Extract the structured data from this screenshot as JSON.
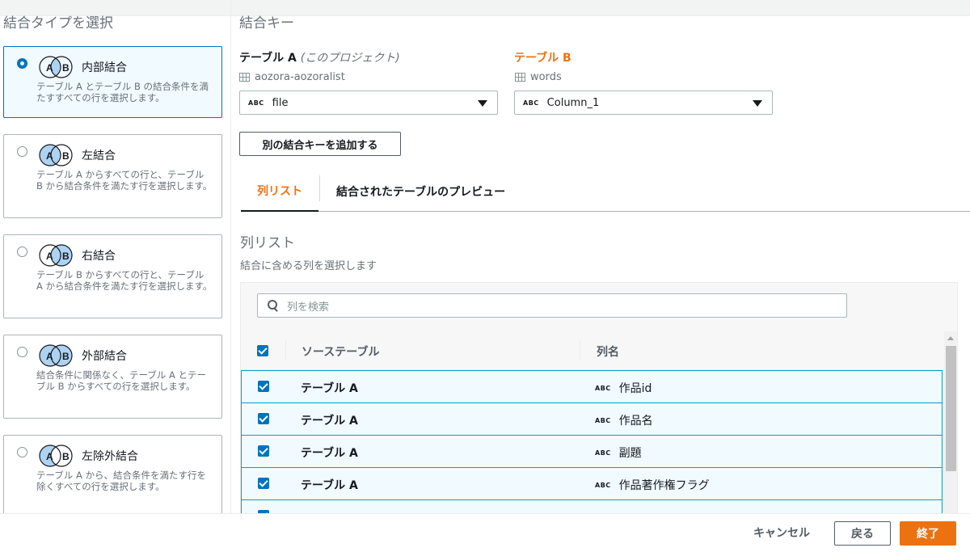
{
  "left_panel": {
    "title": "結合タイプを選択",
    "join_types": [
      {
        "name": "内部結合",
        "description": "テーブル A とテーブル B の結合条件を満たすすべての行を選択します。",
        "selected": true,
        "fill": "inner"
      },
      {
        "name": "左結合",
        "description": "テーブル A からすべての行と、テーブル B から結合条件を満たす行を選択します。",
        "selected": false,
        "fill": "left"
      },
      {
        "name": "右結合",
        "description": "テーブル B からすべての行と、テーブル A から結合条件を満たす行を選択します。",
        "selected": false,
        "fill": "right"
      },
      {
        "name": "外部結合",
        "description": "結合条件に関係なく、テーブル A とテーブル B からすべての行を選択します。",
        "selected": false,
        "fill": "outer"
      },
      {
        "name": "左除外結合",
        "description": "テーブル A から、結合条件を満たす行を除くすべての行を選択します。",
        "selected": false,
        "fill": "left-excl"
      }
    ],
    "venn_labels": {
      "a": "A",
      "b": "B"
    }
  },
  "join_key": {
    "title": "結合キー",
    "table_a": {
      "label": "テーブル A",
      "sublabel": "(このプロジェクト)",
      "table_name": "aozora-aozoralist",
      "selected_column": "file",
      "type": "ABC"
    },
    "table_b": {
      "label": "テーブル B",
      "table_name": "words",
      "selected_column": "Column_1",
      "type": "ABC"
    },
    "add_key_button": "別の結合キーを追加する"
  },
  "tabs": [
    {
      "label": "列リスト",
      "active": true
    },
    {
      "label": "結合されたテーブルのプレビュー",
      "active": false
    }
  ],
  "column_list": {
    "title": "列リスト",
    "subtitle": "結合に含める列を選択します",
    "search_placeholder": "列を検索",
    "headers": {
      "source": "ソーステーブル",
      "column": "列名"
    },
    "rows": [
      {
        "source": "テーブル A",
        "type": "ABC",
        "column": "作品id",
        "checked": true
      },
      {
        "source": "テーブル A",
        "type": "ABC",
        "column": "作品名",
        "checked": true
      },
      {
        "source": "テーブル A",
        "type": "ABC",
        "column": "副題",
        "checked": true
      },
      {
        "source": "テーブル A",
        "type": "ABC",
        "column": "作品著作権フラグ",
        "checked": true
      }
    ]
  },
  "footer": {
    "cancel": "キャンセル",
    "back": "戻る",
    "finish": "終了"
  },
  "colors": {
    "accent": "#ec7211",
    "primary_blue": "#0073bb",
    "venn_fill": "#aed3f2"
  }
}
